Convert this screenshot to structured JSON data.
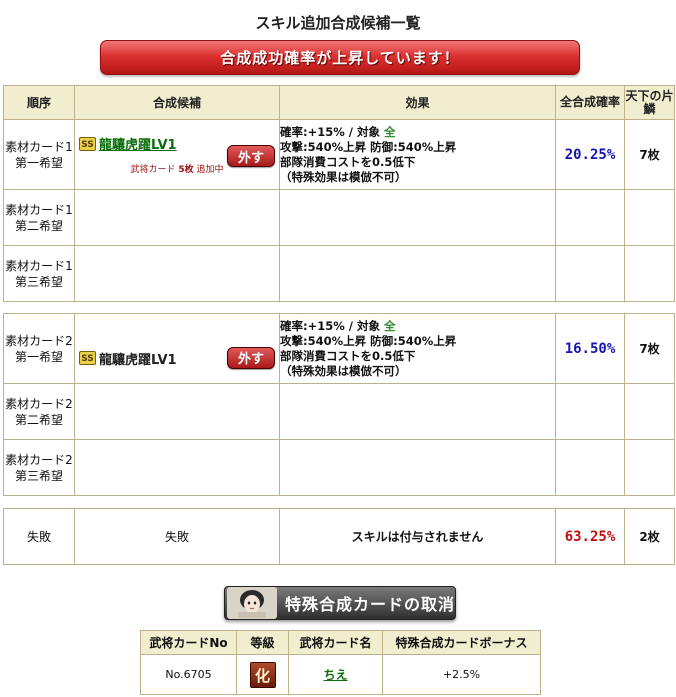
{
  "page": {
    "title": "スキル追加合成候補一覧",
    "banner": "合成成功確率が上昇しています！"
  },
  "table": {
    "headers": {
      "order": "順序",
      "candidate": "合成候補",
      "effect": "効果",
      "total_rate": "全合成確率",
      "tenka": "天下の片鱗"
    },
    "groups": [
      {
        "rows": [
          {
            "order_line1": "素材カード1",
            "order_line2": "第一希望",
            "badge": "SS",
            "name": "龍驤虎躍LV1",
            "remove_label": "外す",
            "sub_prefix": "武将カード",
            "sub_count": "5枚",
            "sub_suffix": "追加中",
            "effect": {
              "line1": "確率:+15% / 対象",
              "target": "全",
              "line2": "攻撃:540%上昇 防御:540%上昇",
              "line3": "部隊消費コストを0.5低下",
              "line4": "（特殊効果は模倣不可）"
            },
            "rate": "20.25%",
            "count": "7枚"
          },
          {
            "order_line1": "素材カード1",
            "order_line2": "第二希望"
          },
          {
            "order_line1": "素材カード1",
            "order_line2": "第三希望"
          }
        ]
      },
      {
        "rows": [
          {
            "order_line1": "素材カード2",
            "order_line2": "第一希望",
            "badge": "SS",
            "name": "龍驤虎躍LV1",
            "remove_label": "外す",
            "effect": {
              "line1": "確率:+15% / 対象",
              "target": "全",
              "line2": "攻撃:540%上昇 防御:540%上昇",
              "line3": "部隊消費コストを0.5低下",
              "line4": "（特殊効果は模倣不可）"
            },
            "rate": "16.50%",
            "count": "7枚"
          },
          {
            "order_line1": "素材カード2",
            "order_line2": "第二希望"
          },
          {
            "order_line1": "素材カード2",
            "order_line2": "第三希望"
          }
        ]
      }
    ],
    "failure": {
      "order": "失敗",
      "candidate": "失敗",
      "effect": "スキルは付与されません",
      "rate": "63.25%",
      "count": "2枚"
    }
  },
  "cancel_button": {
    "label": "特殊合成カードの取消",
    "icon": "general-portrait-icon"
  },
  "special_table": {
    "headers": {
      "card_no": "武将カードNo",
      "rank": "等級",
      "card_name": "武将カード名",
      "bonus": "特殊合成カードボーナス"
    },
    "row": {
      "card_no": "No.6705",
      "rank": "化",
      "card_name": "ちえ",
      "bonus": "+2.5%"
    }
  },
  "colors": {
    "banner": "#dc3232",
    "header_bg": "#f1edcf",
    "border": "#bdb08a",
    "rate_blue": "#1414b4",
    "rate_red": "#c01010",
    "link_green": "#0b6e0b"
  }
}
